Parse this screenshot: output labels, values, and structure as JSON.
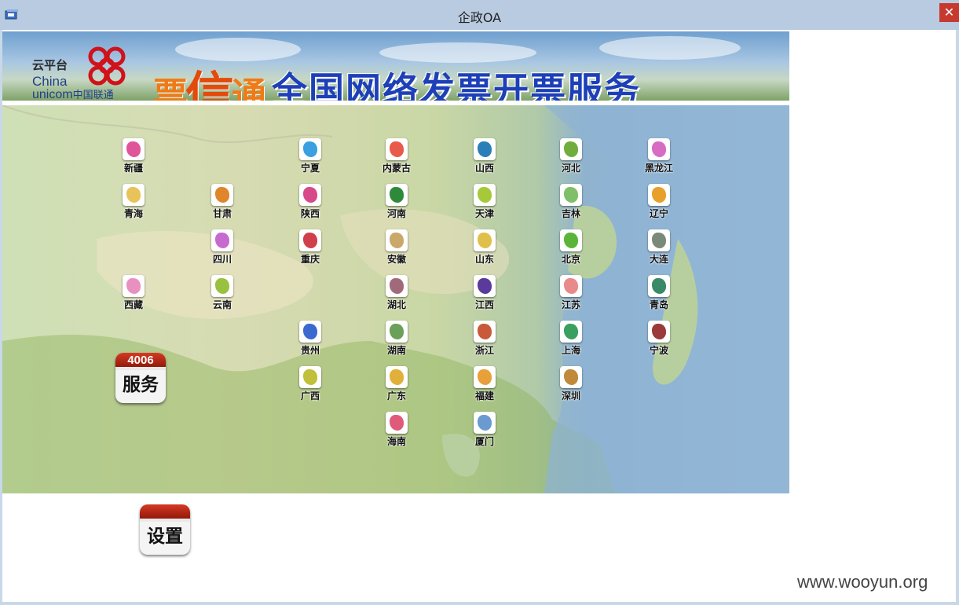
{
  "window": {
    "title": "企政OA",
    "close_label": "✕"
  },
  "banner": {
    "cloud_label": "云平台",
    "china_label": "China",
    "unicom_label": "unicom",
    "unicom_cn_label": "中国联通",
    "brand_label_1": "票",
    "brand_label_2": "信",
    "brand_label_3": "通",
    "headline": "全国网络发票开票服务"
  },
  "provinces": [
    {
      "label": "新疆",
      "color": "#e0559a"
    },
    {
      "label": "宁夏",
      "color": "#3aa0e0"
    },
    {
      "label": "内蒙古",
      "color": "#e85a4a"
    },
    {
      "label": "山西",
      "color": "#2b7fb8"
    },
    {
      "label": "河北",
      "color": "#6fae3d"
    },
    {
      "label": "黑龙江",
      "color": "#d66cc4"
    },
    {
      "label": "青海",
      "color": "#e8c35a"
    },
    {
      "label": "甘肃",
      "color": "#e0862a"
    },
    {
      "label": "陕西",
      "color": "#d74a8a"
    },
    {
      "label": "河南",
      "color": "#2e8a3a"
    },
    {
      "label": "天津",
      "color": "#a6c93a"
    },
    {
      "label": "吉林",
      "color": "#7fbf6a"
    },
    {
      "label": "辽宁",
      "color": "#e8a02a"
    },
    {
      "label": "四川",
      "color": "#c76ad0"
    },
    {
      "label": "重庆",
      "color": "#d0404a"
    },
    {
      "label": "安徽",
      "color": "#c9a86a"
    },
    {
      "label": "山东",
      "color": "#e0c04a"
    },
    {
      "label": "北京",
      "color": "#5ab43a"
    },
    {
      "label": "大连",
      "color": "#7a8a7a"
    },
    {
      "label": "西藏",
      "color": "#e890c0"
    },
    {
      "label": "云南",
      "color": "#9ac040"
    },
    {
      "label": "湖北",
      "color": "#a06a7a"
    },
    {
      "label": "江西",
      "color": "#5a3a9a"
    },
    {
      "label": "江苏",
      "color": "#e88a8a"
    },
    {
      "label": "青岛",
      "color": "#3a8a6a"
    },
    {
      "label": "贵州",
      "color": "#3a6ad0"
    },
    {
      "label": "湖南",
      "color": "#6aa05a"
    },
    {
      "label": "浙江",
      "color": "#c85a3a"
    },
    {
      "label": "上海",
      "color": "#3aa060"
    },
    {
      "label": "宁波",
      "color": "#9a3a3a"
    },
    {
      "label": "广西",
      "color": "#c0c03a"
    },
    {
      "label": "广东",
      "color": "#e0b03a"
    },
    {
      "label": "福建",
      "color": "#e8a03a"
    },
    {
      "label": "深圳",
      "color": "#c08a3a"
    },
    {
      "label": "海南",
      "color": "#e05a7a"
    },
    {
      "label": "厦门",
      "color": "#6a9ad0"
    }
  ],
  "service_badge": {
    "top": "4006",
    "label": "服务"
  },
  "settings_badge": {
    "label": "设置"
  },
  "watermark": "www.wooyun.org"
}
